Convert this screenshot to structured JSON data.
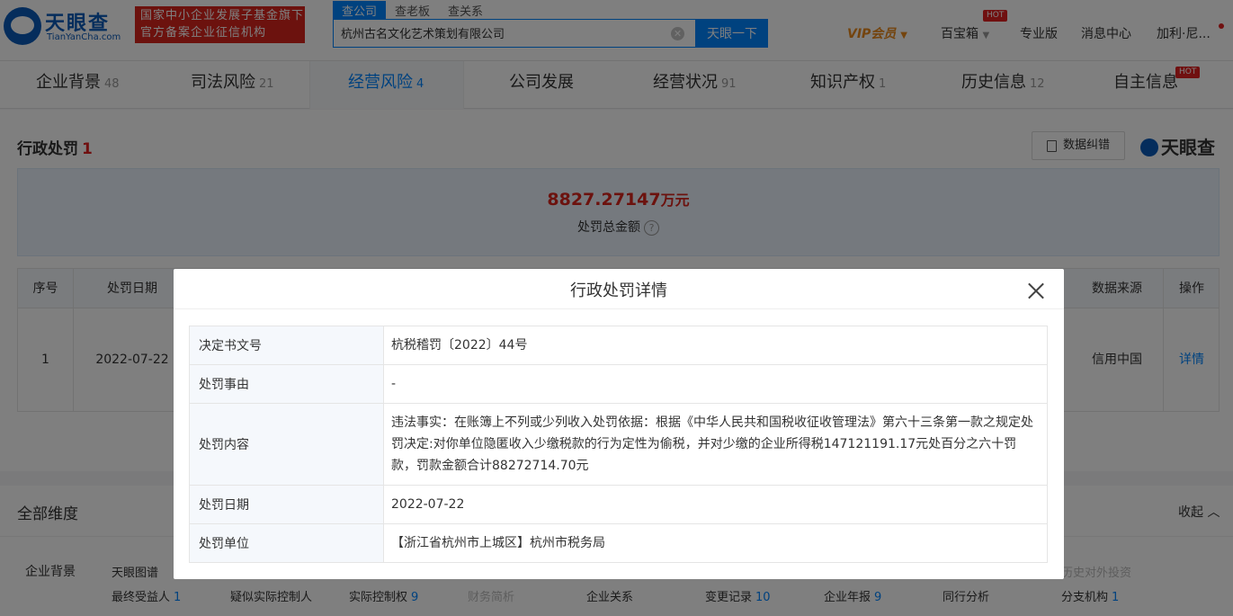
{
  "header": {
    "logo_cn": "天眼查",
    "logo_en": "TianYanCha.com",
    "badge_line1": "国家中小企业发展子基金旗下",
    "badge_line2": "官方备案企业征信机构",
    "search_tabs": [
      "查公司",
      "查老板",
      "查关系"
    ],
    "search_value": "杭州古名文化艺术策划有限公司",
    "search_button": "天眼一下",
    "vip": "VIP会员",
    "baibaoxiang": "百宝箱",
    "hot": "HOT",
    "pro": "专业版",
    "messages": "消息中心",
    "user": "加利·尼..."
  },
  "tabs": [
    {
      "label": "企业背景",
      "count": "48"
    },
    {
      "label": "司法风险",
      "count": "21"
    },
    {
      "label": "经营风险",
      "count": "4"
    },
    {
      "label": "公司发展",
      "count": ""
    },
    {
      "label": "经营状况",
      "count": "91"
    },
    {
      "label": "知识产权",
      "count": "1"
    },
    {
      "label": "历史信息",
      "count": "12"
    },
    {
      "label": "自主信息",
      "count": ""
    }
  ],
  "section": {
    "title": "行政处罚",
    "count": "1",
    "feedback": "数据纠错",
    "brand": "天眼查"
  },
  "summary": {
    "amount": "8827.27147",
    "unit": "万元",
    "label": "处罚总金额",
    "help": "?"
  },
  "table": {
    "headers": {
      "index": "序号",
      "date": "处罚日期",
      "source": "数据来源",
      "action": "操作"
    },
    "row": {
      "index": "1",
      "date": "2022-07-22",
      "source": "信用中国",
      "action": "详情"
    }
  },
  "bottom": {
    "title": "全部维度",
    "collapse": "收起",
    "dim_label": "企业背景",
    "row1": [
      "天眼图谱",
      "历史对外投资"
    ],
    "row2": [
      {
        "label": "最终受益人",
        "n": "1"
      },
      {
        "label": "疑似实际控制人",
        "n": ""
      },
      {
        "label": "实际控制权",
        "n": "9"
      },
      {
        "label": "财务简析",
        "n": ""
      },
      {
        "label": "企业关系",
        "n": ""
      },
      {
        "label": "变更记录",
        "n": "10"
      },
      {
        "label": "企业年报",
        "n": "9"
      },
      {
        "label": "同行分析",
        "n": ""
      },
      {
        "label": "分支机构",
        "n": "1"
      }
    ]
  },
  "modal": {
    "title": "行政处罚详情",
    "rows": [
      {
        "key": "决定书文号",
        "value": "杭税稽罚〔2022〕44号"
      },
      {
        "key": "处罚事由",
        "value": "-"
      },
      {
        "key": "处罚内容",
        "value": "违法事实：在账簿上不列或少列收入处罚依据：根据《中华人民共和国税收征收管理法》第六十三条第一款之规定处罚决定:对你单位隐匿收入少缴税款的行为定性为偷税，并对少缴的企业所得税147121191.17元处百分之六十罚款，罚款金额合计88272714.70元"
      },
      {
        "key": "处罚日期",
        "value": "2022-07-22"
      },
      {
        "key": "处罚单位",
        "value": "【浙江省杭州市上城区】杭州市税务局"
      }
    ]
  }
}
